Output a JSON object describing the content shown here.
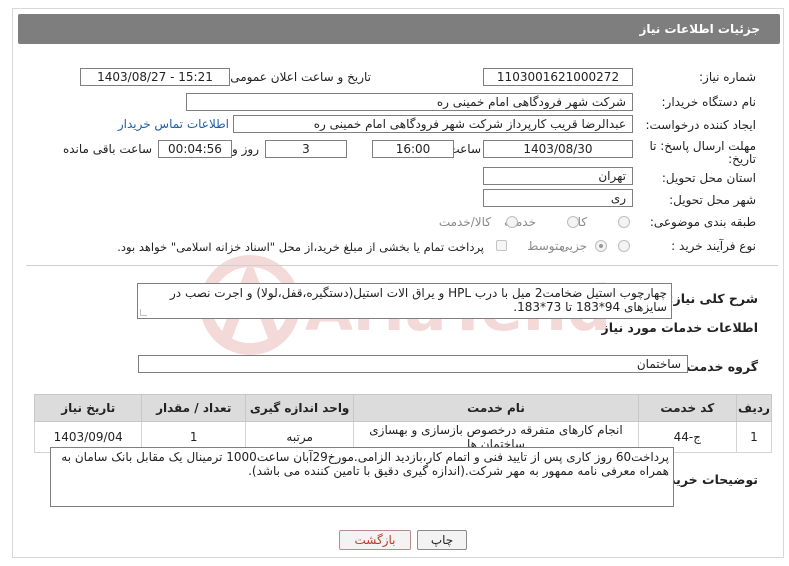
{
  "header": {
    "title": "جزئیات اطلاعات نیاز"
  },
  "need_number": {
    "label": "شماره نیاز:",
    "value": "1103001621000272"
  },
  "announce_datetime": {
    "label": "تاریخ و ساعت اعلان عمومی:",
    "value": "1403/08/27 - 15:21"
  },
  "buyer_org": {
    "label": "نام دستگاه خریدار:",
    "value": "شرکت شهر فرودگاهی امام خمینی  ره"
  },
  "requester": {
    "label": "ایجاد کننده درخواست:",
    "value": "عبدالرضا قریب کارپرداز شرکت شهر فرودگاهی امام خمینی  ره",
    "contact_link": "اطلاعات تماس خریدار"
  },
  "deadline": {
    "label_line1": "مهلت ارسال پاسخ: تا",
    "label_line2": "تاریخ:",
    "date": "1403/08/30",
    "time_label": "ساعت",
    "time": "16:00",
    "days": "3",
    "days_label": "روز و",
    "remaining": "00:04:56",
    "remaining_label": "ساعت باقی مانده"
  },
  "province": {
    "label": "استان محل تحویل:",
    "value": "تهران"
  },
  "city": {
    "label": "شهر محل تحویل:",
    "value": "ری"
  },
  "category": {
    "label": "طبقه بندی موضوعی:",
    "options": [
      "کالا",
      "خدمت",
      "کالا/خدمت"
    ]
  },
  "process": {
    "label": "نوع فرآیند خرید :",
    "options": [
      "جزیی",
      "متوسط"
    ],
    "payment_note": "پرداخت تمام یا بخشی از مبلغ خرید،از محل \"اسناد خزانه اسلامی\" خواهد بود."
  },
  "summary": {
    "label": "شرح کلی نیاز:",
    "text": "چهارچوب استیل ضخامت2 میل با درب HPL و یراق الات استیل(دستگیره،قفل،لولا) و اجرت نصب در سایزهای 94*183 تا 73*183."
  },
  "services_title": "اطلاعات خدمات مورد نیاز",
  "service_group": {
    "label": "گروه خدمت:",
    "value": "ساختمان"
  },
  "table": {
    "headers": [
      "ردیف",
      "کد خدمت",
      "نام خدمت",
      "واحد اندازه گیری",
      "تعداد / مقدار",
      "تاریخ نیاز"
    ],
    "rows": [
      [
        "1",
        "ج-44",
        "انجام کارهای متفرقه درخصوص بازسازی و بهسازی ساختمان ها",
        "مرتبه",
        "1",
        "1403/09/04"
      ]
    ]
  },
  "buyer_notes": {
    "label": "توضیحات خریدار:",
    "text": "پرداخت60 روز کاری پس از تایید فنی و اتمام کار،بازدید الزامی.مورخ29آبان ساعت1000 ترمینال یک مقابل بانک سامان به همراه معرفی نامه ممهور به مهر شرکت.(اندازه گیری دقیق با تامین کننده می باشد)."
  },
  "buttons": {
    "print": "چاپ",
    "back": "بازگشت"
  },
  "watermark": {
    "text": "AriaTender.net"
  },
  "colors": {
    "header_bg": "#7e7e7e",
    "link": "#1f5fa8",
    "back_text": "#c0392b",
    "watermark": "#c0392b"
  }
}
